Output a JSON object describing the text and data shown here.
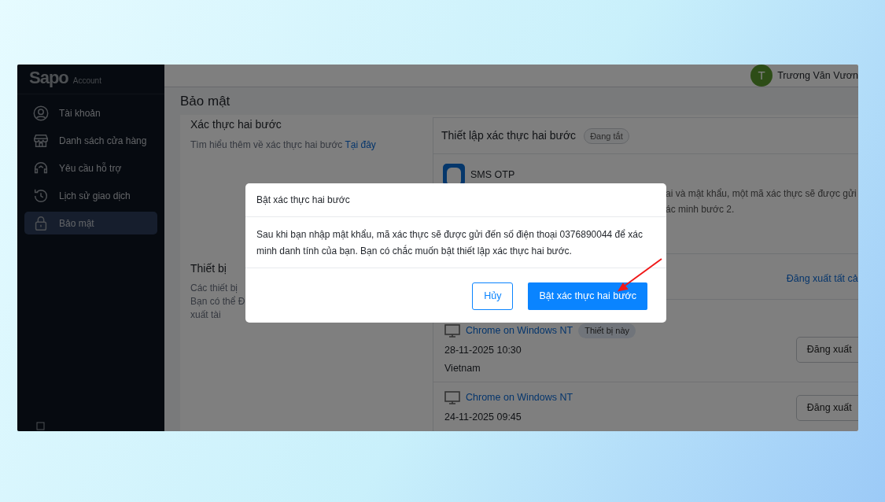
{
  "brand": {
    "logo": "Sapo",
    "subtitle": "Account"
  },
  "sidebar": {
    "items": [
      {
        "label": "Tài khoản",
        "selected": false
      },
      {
        "label": "Danh sách cửa hàng",
        "selected": false
      },
      {
        "label": "Yêu cầu hỗ trợ",
        "selected": false
      },
      {
        "label": "Lịch sử giao dịch",
        "selected": false
      },
      {
        "label": "Bảo mật",
        "selected": true
      }
    ]
  },
  "topbar": {
    "avatar_letter": "T",
    "user_name": "Trương Văn Vươn"
  },
  "page_title": "Bảo mật",
  "two_step": {
    "title": "Xác thực hai bước",
    "description": "Tìm hiểu thêm về xác thực hai bước",
    "link": "Tại đây",
    "setup_title": "Thiết lập xác thực hai bước",
    "status": "Đang tắt",
    "method": {
      "name": "SMS OTP",
      "description_lines": [
        "ai và mật khẩu, một mã xác thực sẽ được gửi",
        "ác minh bước 2."
      ]
    }
  },
  "devices": {
    "title": "Thiết bị",
    "description_lines": [
      "Các thiết bị",
      "Bạn có thể Đ",
      "xuất tài"
    ],
    "logout_all": "Đăng xuất tất cả",
    "items": [
      {
        "name": "Chrome on Windows NT",
        "badge": "Thiết bị này",
        "time": "28-11-2025 10:30",
        "country": "Vietnam",
        "action": "Đăng xuất"
      },
      {
        "name": "Chrome on Windows NT",
        "time": "24-11-2025 09:45",
        "action": "Đăng xuất"
      }
    ]
  },
  "modal": {
    "title": "Bật xác thực hai bước",
    "body": "Sau khi bạn nhập mật khẩu, mã xác thực sẽ được gửi đến số điện thoại 0376890044 để xác minh danh tính của bạn. Bạn có chắc muốn bật thiết lập xác thực hai bước.",
    "cancel": "Hủy",
    "confirm": "Bật xác thực hai bước"
  }
}
